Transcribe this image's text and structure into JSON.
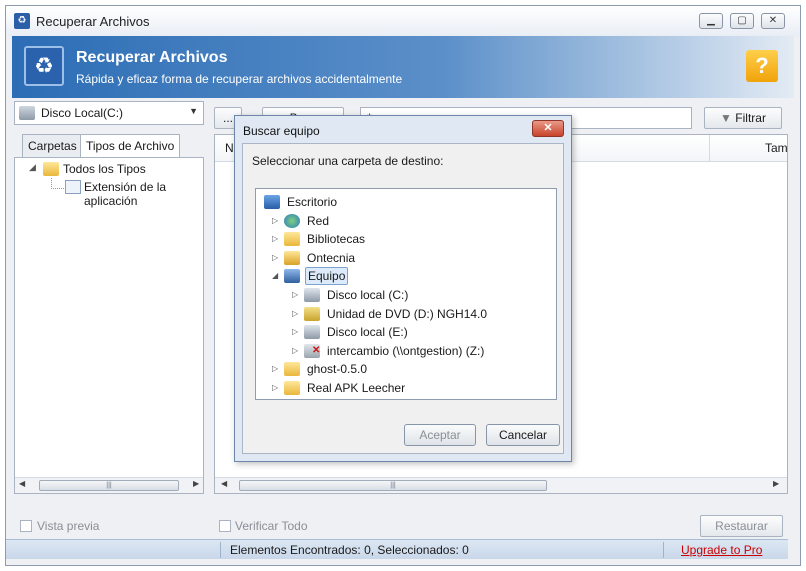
{
  "window": {
    "title": "Recuperar Archivos",
    "controls": [
      "minimize-icon",
      "maximize-icon",
      "close-icon"
    ]
  },
  "header": {
    "title": "Recuperar Archivos",
    "subtitle": "Rápida y eficaz forma de recuperar archivos accidentalmente",
    "help_label": "?"
  },
  "toolbar": {
    "drive_selected": "Disco Local(C:)",
    "browse_label": "...",
    "search_button_label": "Buscar",
    "search_value": "*.exe",
    "filter_label": "Filtrar"
  },
  "left_tabs": [
    {
      "label": "Carpetas",
      "active": false
    },
    {
      "label": "Tipos de Archivo",
      "active": true
    }
  ],
  "left_tree": {
    "root": "Todos los Tipos",
    "child": "Extensión de la aplicación"
  },
  "list": {
    "columns": [
      "N",
      "Tam"
    ]
  },
  "bottom": {
    "preview_label": "Vista previa",
    "verify_label": "Verificar Todo",
    "restore_label": "Restaurar"
  },
  "status": {
    "found_text": "Elementos Encontrados: 0, Seleccionados: 0",
    "upgrade_link": "Upgrade to Pro"
  },
  "dialog": {
    "title": "Buscar equipo",
    "prompt": "Seleccionar una carpeta de destino:",
    "tree": [
      {
        "label": "Escritorio",
        "level": 0,
        "icon": "desktop-icon"
      },
      {
        "label": "Red",
        "level": 1,
        "icon": "network-icon"
      },
      {
        "label": "Bibliotecas",
        "level": 1,
        "icon": "libraries-icon"
      },
      {
        "label": "Ontecnia",
        "level": 1,
        "icon": "user-folder-icon"
      },
      {
        "label": "Equipo",
        "level": 1,
        "icon": "computer-icon",
        "expanded": true,
        "selected": true
      },
      {
        "label": "Disco local (C:)",
        "level": 2,
        "icon": "drive-icon"
      },
      {
        "label": "Unidad de DVD (D:) NGH14.0",
        "level": 2,
        "icon": "dvd-drive-icon"
      },
      {
        "label": "Disco local (E:)",
        "level": 2,
        "icon": "drive-icon"
      },
      {
        "label": "intercambio (\\\\ontgestion) (Z:)",
        "level": 2,
        "icon": "network-drive-icon"
      },
      {
        "label": "ghost-0.5.0",
        "level": 1,
        "icon": "folder-icon"
      },
      {
        "label": "Real APK Leecher",
        "level": 1,
        "icon": "folder-icon"
      }
    ],
    "accept_label": "Aceptar",
    "cancel_label": "Cancelar"
  },
  "colors": {
    "header_blue": "#2c6db5",
    "help_orange": "#f0a30a",
    "close_red": "#c8432c",
    "link_red": "#cc0000"
  }
}
